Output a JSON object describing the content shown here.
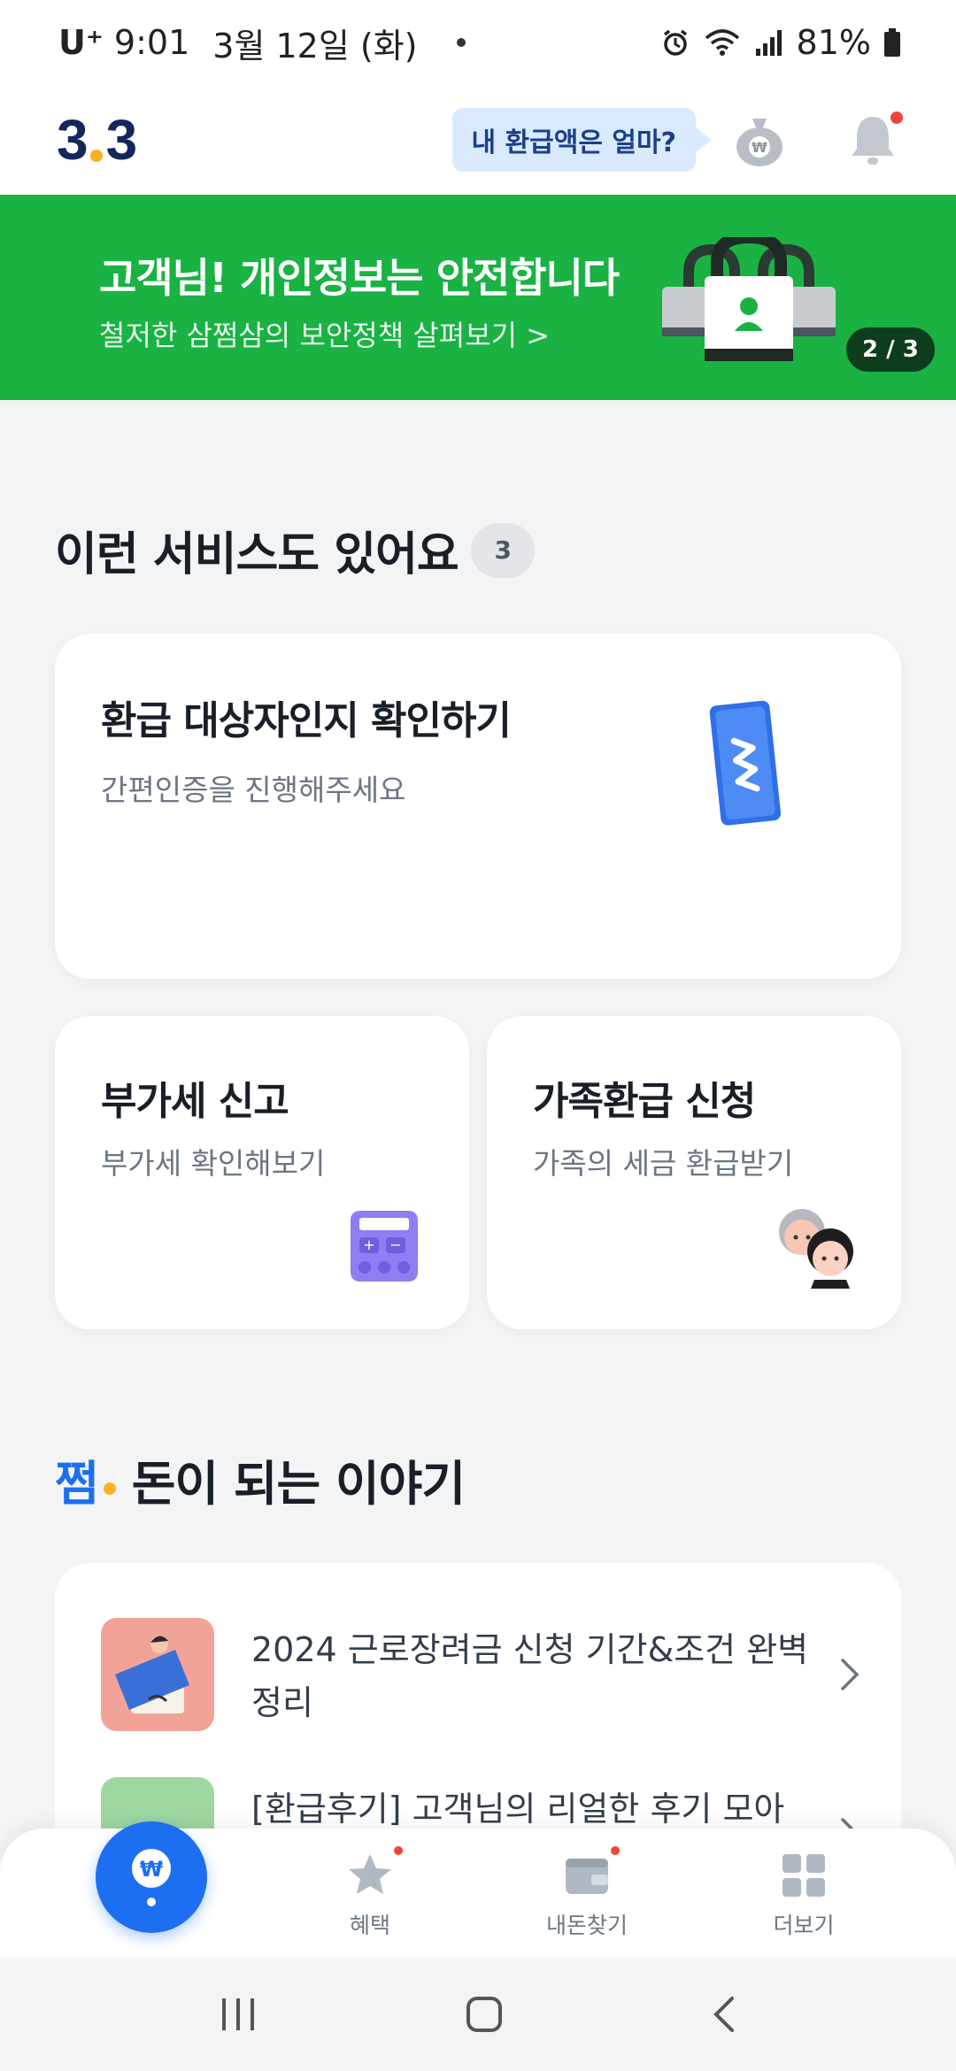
{
  "status_bar": {
    "carrier": "U⁺",
    "time": "9:01",
    "date": "3월 12일 (화)",
    "battery": "81%"
  },
  "header": {
    "logo_main": "3",
    "logo_sub": "3",
    "refund_prompt": "내 환급액은 얼마?",
    "icons": [
      "money-bag-icon",
      "bell-icon"
    ]
  },
  "banner": {
    "title": "고객님! 개인정보는 안전합니다",
    "subtitle": "철저한 삼쩜삼의 보안정책 살펴보기 >",
    "counter": "2 / 3",
    "color": "#19b243"
  },
  "services": {
    "title": "이런 서비스도 있어요",
    "count": "3",
    "cards": [
      {
        "title": "환급 대상자인지 확인하기",
        "desc": "간편인증을 진행해주세요",
        "icon": "ticket-icon"
      },
      {
        "title": "부가세 신고",
        "desc": "부가세 확인해보기",
        "icon": "calculator-icon"
      },
      {
        "title": "가족환급 신청",
        "desc": "가족의 세금 환급받기",
        "icon": "family-icon"
      }
    ]
  },
  "stories": {
    "brand": "쩜",
    "title": "돈이 되는 이야기",
    "items": [
      {
        "text": "2024 근로장려금 신청 기간&조건 완벽 정리"
      },
      {
        "text": "[환급후기] 고객님의 리얼한 후기 모아"
      }
    ]
  },
  "bottom_nav": {
    "items": [
      {
        "label": "",
        "icon": "won-pin-icon"
      },
      {
        "label": "혜택",
        "icon": "star-icon"
      },
      {
        "label": "내돈찾기",
        "icon": "wallet-icon"
      },
      {
        "label": "더보기",
        "icon": "grid-icon"
      }
    ],
    "accent": "#1d6ff2"
  }
}
